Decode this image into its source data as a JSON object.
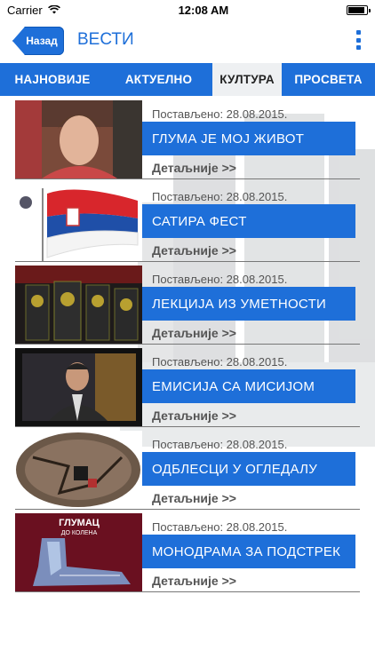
{
  "status": {
    "carrier": "Carrier",
    "time": "12:08 AM"
  },
  "nav": {
    "back_label": "Назад",
    "title": "ВЕСТИ"
  },
  "tabs": [
    {
      "label": "НАЈНОВИЈЕ"
    },
    {
      "label": "АКТУЕЛНО"
    },
    {
      "label": "КУЛТУРА"
    },
    {
      "label": "ПРОСВЕТА"
    }
  ],
  "news": [
    {
      "date": "Постављено: 28.08.2015.",
      "title": "ГЛУМА ЈЕ МОЈ ЖИВОТ",
      "more": "Детаљније >>"
    },
    {
      "date": "Постављено: 28.08.2015.",
      "title": "САТИРА ФЕСТ",
      "more": "Детаљније >>"
    },
    {
      "date": "Постављено: 28.08.2015.",
      "title": "ЛЕКЦИЈА ИЗ УМЕТНОСТИ",
      "more": "Детаљније >>"
    },
    {
      "date": "Постављено: 28.08.2015.",
      "title": "ЕМИСИЈА СА МИСИЈОМ",
      "more": "Детаљније >>"
    },
    {
      "date": "Постављено: 28.08.2015.",
      "title": "ОДБЛЕСЦИ У ОГЛЕДАЛУ",
      "more": "Детаљније >>"
    },
    {
      "date": "Постављено: 28.08.2015.",
      "title": "МОНОДРАМА ЗА ПОДСТРЕК",
      "more": "Детаљније >>"
    }
  ],
  "thumb_texts": {
    "poster_line1": "ГЛУМАЦ",
    "poster_line2": "ДО КОЛЕНА"
  },
  "colors": {
    "accent": "#1e6fd9",
    "tab_active_bg": "#eef0f2"
  }
}
